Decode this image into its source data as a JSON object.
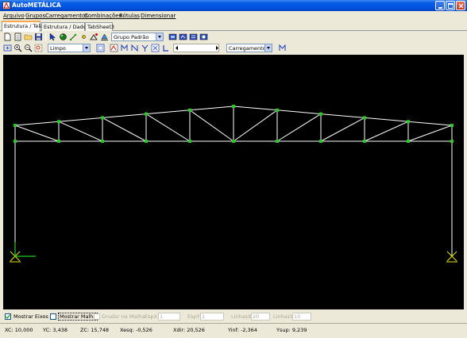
{
  "window": {
    "title": "AutoMETÁLICA"
  },
  "menu": [
    "Arquivo",
    "Grupos",
    "Carregamentos",
    "Combinações",
    "Rótulas",
    "Dimensionar"
  ],
  "tabs": [
    "Estrutura / Tela",
    "Estrutura / Dados",
    "TabSheet3"
  ],
  "toolbar1": {
    "group_combo": "Grupo Padrão"
  },
  "toolbar2": {
    "view_combo": "Limpo",
    "load_combo": "Carregamento P"
  },
  "options": {
    "show_axes_label": "Mostrar Eixos",
    "show_axes_checked": true,
    "show_mesh_label": "Mostrar Malha",
    "show_mesh_checked": false,
    "snap_mesh_label": "Grudar na Malha",
    "espx_label": "EspX",
    "espx_value": "1",
    "espy_label": "EspY",
    "espy_value": "1",
    "linhasx_label": "LinhasX",
    "linhasx_value": "20",
    "linhasy_label": "LinhasY",
    "linhasy_value": "10"
  },
  "status": {
    "xc": "XC: 10,000",
    "yc": "YC: 3,438",
    "zc": "ZC: 15,748",
    "xesq": "Xesq: -0,526",
    "xdir": "Xdir: 20,526",
    "yinf": "Yinf: -2,364",
    "ysup": "Ysup: 9,239"
  },
  "colors": {
    "canvas_bg": "#000000",
    "members": "#ffffff",
    "nodes": "#22cc22",
    "supports": "#e6e600",
    "axes": "#22cc22"
  },
  "icons": {
    "toolbar1": [
      "new-file-icon",
      "document-icon",
      "open-folder-icon",
      "save-icon",
      "select-arrow-icon",
      "sphere-icon",
      "node-icon",
      "point-icon",
      "member-icon",
      "support-icon",
      "view-icon",
      "view-icon",
      "view-icon",
      "view-icon"
    ],
    "toolbar2": [
      "zoom-extents-icon",
      "zoom-in-icon",
      "zoom-out-icon",
      "zoom-window-icon",
      "frame-icon",
      "render-icon",
      "node-label-icon",
      "member-label-icon",
      "axis-icon",
      "load-icon",
      "length-icon",
      "scroll-left-icon",
      "scroll-right-icon",
      "load-case-icon"
    ]
  }
}
